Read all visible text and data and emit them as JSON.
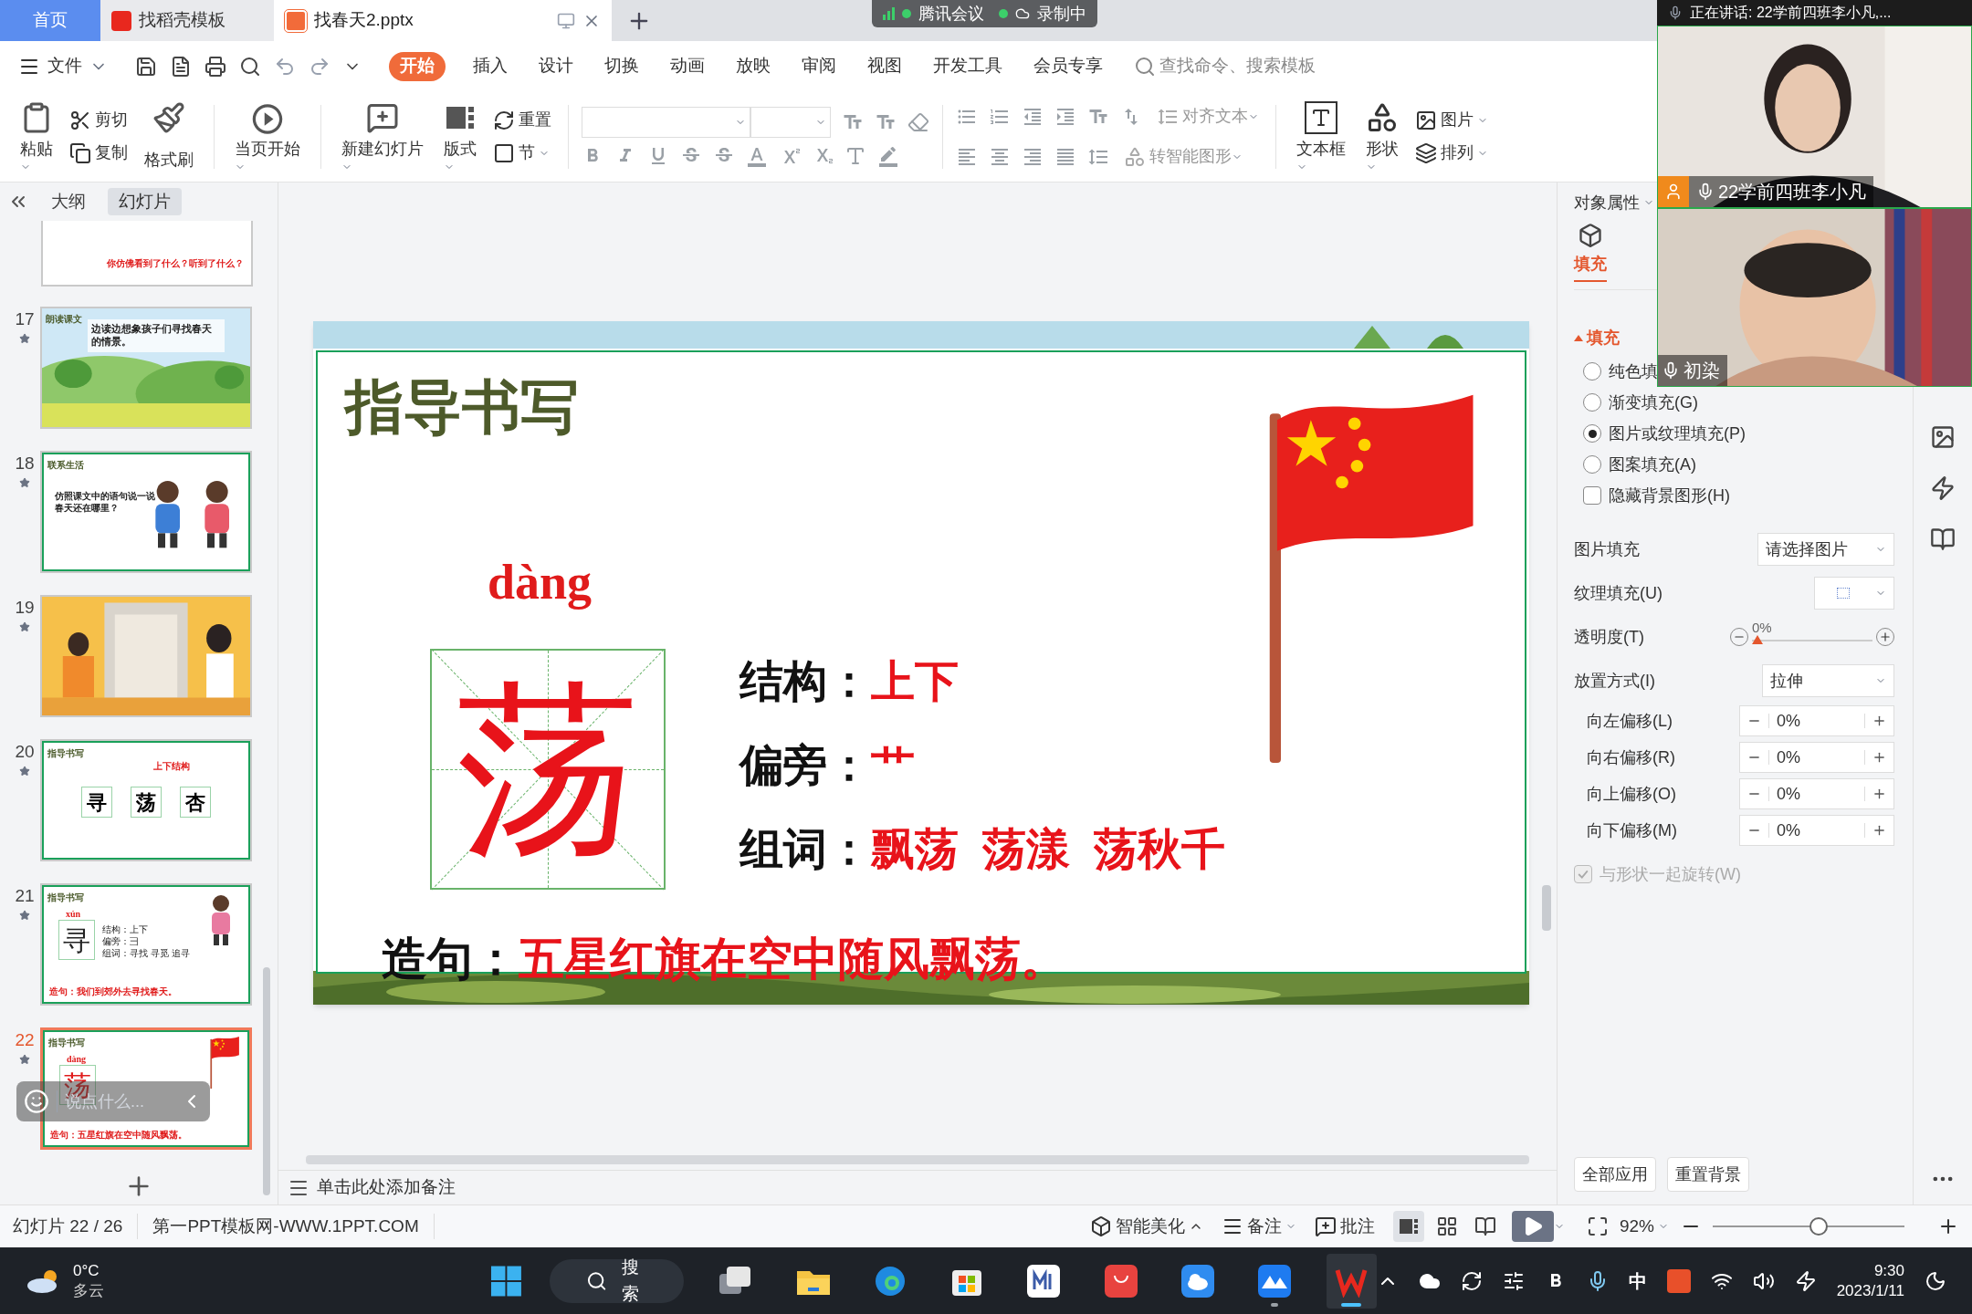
{
  "tabs": [
    {
      "label": "首页",
      "selected": false,
      "kind": "home"
    },
    {
      "label": "找稻壳模板",
      "selected": false,
      "kind": "docer"
    },
    {
      "label": "找春天2.pptx",
      "selected": true,
      "kind": "document"
    }
  ],
  "meeting_bar": {
    "app": "腾讯会议",
    "status": "录制中"
  },
  "menu": {
    "file": "文件",
    "items": [
      {
        "label": "开始",
        "selected": true
      },
      {
        "label": "插入",
        "selected": false
      },
      {
        "label": "设计",
        "selected": false
      },
      {
        "label": "切换",
        "selected": false
      },
      {
        "label": "动画",
        "selected": false
      },
      {
        "label": "放映",
        "selected": false
      },
      {
        "label": "审阅",
        "selected": false
      },
      {
        "label": "视图",
        "selected": false
      },
      {
        "label": "开发工具",
        "selected": false
      },
      {
        "label": "会员专享",
        "selected": false
      }
    ],
    "search": {
      "placeholder": "查找命令、搜索模板"
    }
  },
  "ribbon": {
    "paste": "粘贴",
    "cut": "剪切",
    "copy": "复制",
    "format_painter": "格式刷",
    "play_from_current": "当页开始",
    "new_slide": "新建幻灯片",
    "layout": "版式",
    "reset": "重置",
    "section": "节",
    "align_text": "对齐文本",
    "smart_art": "转智能图形",
    "text_box": "文本框",
    "shape": "形状",
    "picture": "图片",
    "arrange": "排列"
  },
  "side_tabs": [
    {
      "label": "大纲",
      "selected": false
    },
    {
      "label": "幻灯片",
      "selected": true
    }
  ],
  "slides": [
    {
      "selected": false,
      "kind": "partial",
      "text": "你仿佛看到了什么？听到了什么？"
    },
    {
      "number": "17",
      "selected": false,
      "kind": "scene",
      "heading": "朗读课文",
      "text": "边读边想象孩子们寻找春天的情景。"
    },
    {
      "number": "18",
      "selected": false,
      "kind": "illustrated",
      "heading": "联系生活",
      "text": "仿照课文中的语句说一说春天还在哪里？"
    },
    {
      "number": "19",
      "selected": false,
      "kind": "picture"
    },
    {
      "number": "20",
      "selected": false,
      "kind": "characters",
      "heading": "指导书写",
      "note": "上下结构",
      "characters": [
        "寻",
        "荡",
        "杏"
      ]
    },
    {
      "number": "21",
      "selected": false,
      "kind": "lesson",
      "heading": "指导书写",
      "pinyin": "xún",
      "character": "寻",
      "lines": [
        "结构：上下",
        "偏旁：彐",
        "组词：寻找 寻觅 追寻"
      ],
      "sentence": "造句：我们到郊外去寻找春天。"
    },
    {
      "number": "22",
      "selected": true,
      "kind": "lesson",
      "heading": "指导书写",
      "pinyin": "dàng",
      "character": "荡",
      "sentence": "造句：五星红旗在空中随风飘荡。"
    }
  ],
  "chat": {
    "placeholder": "说点什么..."
  },
  "slide": {
    "title": "指导书写",
    "pinyin": "dàng",
    "character": "荡",
    "lines": [
      {
        "label": "结构：",
        "values": [
          "上下"
        ]
      },
      {
        "label": "偏旁：",
        "values": [
          "艹"
        ]
      },
      {
        "label": "组词：",
        "values": [
          "飘荡",
          "荡漾",
          "荡秋千"
        ]
      }
    ],
    "sentence": {
      "label": "造句：",
      "value": "五星红旗在空中随风飘荡。"
    }
  },
  "notes": {
    "placeholder": "单击此处添加备注"
  },
  "properties": {
    "title": "对象属性",
    "tabs": [
      {
        "label": "填充",
        "selected": true
      }
    ],
    "section": {
      "label": "填充",
      "expanded": true
    },
    "fill_options": [
      {
        "label": "纯色填",
        "selected": false
      },
      {
        "label": "渐变填充(G)",
        "selected": false
      },
      {
        "label": "图片或纹理填充(P)",
        "selected": true
      },
      {
        "label": "图案填充(A)",
        "selected": false
      }
    ],
    "hide_background": {
      "label": "隐藏背景图形(H)",
      "checked": false
    },
    "picture_fill": {
      "label": "图片填充",
      "value": "请选择图片"
    },
    "texture_fill": {
      "label": "纹理填充(U)"
    },
    "transparency": {
      "label": "透明度(T)",
      "reading": "0%",
      "level": 0
    },
    "placement": {
      "label": "放置方式(I)",
      "value": "拉伸"
    },
    "offsets": [
      {
        "label": "向左偏移(L)",
        "value": "0%"
      },
      {
        "label": "向右偏移(R)",
        "value": "0%"
      },
      {
        "label": "向上偏移(O)",
        "value": "0%"
      },
      {
        "label": "向下偏移(M)",
        "value": "0%"
      }
    ],
    "rotate_with_shape": {
      "label": "与形状一起旋转(W)",
      "checked": true,
      "disabled": true
    },
    "buttons": [
      "全部应用",
      "重置背景"
    ]
  },
  "video": {
    "speaking": "正在讲话: 22学前四班李小凡,...",
    "participants": [
      {
        "name": "22学前四班李小凡",
        "host": true
      },
      {
        "name": "初染",
        "host": false
      }
    ]
  },
  "status_bar": {
    "slide_counter": "幻灯片 22 / 26",
    "template": "第一PPT模板网-WWW.1PPT.COM",
    "beautify": "智能美化",
    "notes": "备注",
    "comment": "批注",
    "views": [
      {
        "kind": "normal",
        "selected": true
      },
      {
        "kind": "sorter",
        "selected": false
      },
      {
        "kind": "reading",
        "selected": false
      }
    ],
    "zoom": "92%",
    "zoom_slider": {
      "level": 0.55
    }
  },
  "taskbar": {
    "weather": {
      "temperature": "0°C",
      "condition": "多云"
    },
    "search": "搜索",
    "apps": [
      {
        "kind": "task-view",
        "running": false,
        "selected": false
      },
      {
        "kind": "folder",
        "running": false,
        "selected": false
      },
      {
        "kind": "browser",
        "running": false,
        "selected": false
      },
      {
        "kind": "store",
        "running": false,
        "selected": false
      },
      {
        "kind": "m-app",
        "running": false,
        "selected": false
      },
      {
        "kind": "shop",
        "running": false,
        "selected": false
      },
      {
        "kind": "cloud",
        "running": false,
        "selected": false
      },
      {
        "kind": "mountain",
        "running": true,
        "selected": false
      },
      {
        "kind": "wps",
        "running": true,
        "selected": true
      }
    ],
    "ime": "中",
    "time": "9:30",
    "date": "2023/1/11"
  }
}
